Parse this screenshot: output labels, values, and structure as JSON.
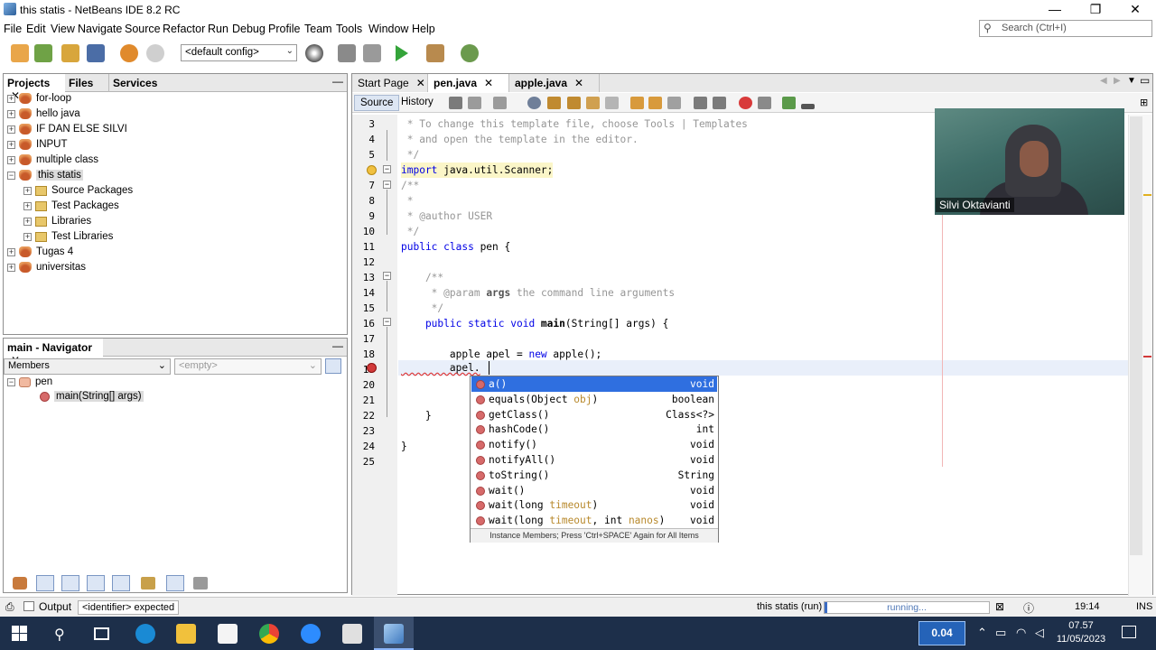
{
  "window": {
    "title": "this statis - NetBeans IDE 8.2 RC",
    "controls": [
      "—",
      "❐",
      "✕"
    ]
  },
  "menu": [
    "File",
    "Edit",
    "View",
    "Navigate",
    "Source",
    "Refactor",
    "Run",
    "Debug",
    "Profile",
    "Team",
    "Tools",
    "Window",
    "Help"
  ],
  "search": {
    "placeholder": "Search (Ctrl+I)"
  },
  "toolbar": {
    "config": "<default config>"
  },
  "projects_panel": {
    "tabs": [
      "Projects",
      "Files",
      "Services"
    ],
    "close": "✕",
    "minimize": "—",
    "tree": [
      {
        "label": "for-loop",
        "level": 0,
        "kind": "project"
      },
      {
        "label": "hello java",
        "level": 0,
        "kind": "project"
      },
      {
        "label": "IF DAN ELSE SILVI",
        "level": 0,
        "kind": "project"
      },
      {
        "label": "INPUT",
        "level": 0,
        "kind": "project"
      },
      {
        "label": "multiple class",
        "level": 0,
        "kind": "project"
      },
      {
        "label": "this statis",
        "level": 0,
        "kind": "project",
        "expanded": true,
        "selected": true
      },
      {
        "label": "Source Packages",
        "level": 1,
        "kind": "folder"
      },
      {
        "label": "Test Packages",
        "level": 1,
        "kind": "folder"
      },
      {
        "label": "Libraries",
        "level": 1,
        "kind": "folder"
      },
      {
        "label": "Test Libraries",
        "level": 1,
        "kind": "folder"
      },
      {
        "label": "Tugas 4",
        "level": 0,
        "kind": "project"
      },
      {
        "label": "universitas",
        "level": 0,
        "kind": "project"
      }
    ]
  },
  "navigator": {
    "title": "main - Navigator",
    "filter": "Members",
    "scope": "<empty>",
    "root": "pen",
    "child": "main(String[] args)"
  },
  "editor": {
    "tabs": [
      {
        "label": "Start Page",
        "active": false
      },
      {
        "label": "pen.java",
        "active": true
      },
      {
        "label": "apple.java",
        "active": false
      }
    ],
    "subtabs": [
      "Source",
      "History"
    ],
    "line_numbers": [
      "3",
      "4",
      "5",
      "6",
      "7",
      "8",
      "9",
      "10",
      "11",
      "12",
      "13",
      "14",
      "15",
      "16",
      "17",
      "18",
      "19",
      "20",
      "21",
      "22",
      "23",
      "24",
      "25"
    ]
  },
  "code": {
    "l3": " * To change this template file, choose Tools | Templates",
    "l4": " * and open the template in the editor.",
    "l5": " */",
    "l6_kw": "import",
    "l6_rest": " java.util.Scanner;",
    "l7": "/**",
    "l8": " *",
    "l9_a": " * ",
    "l9_tag": "@author",
    "l9_b": " USER",
    "l10": " */",
    "l11_kw": "public class",
    "l11_rest": " pen {",
    "l13": "    /**",
    "l14_a": "     * ",
    "l14_tag": "@param",
    "l14_arg": " args",
    "l14_b": " the command line arguments",
    "l15": "     */",
    "l16_kw": "    public static void",
    "l16_name": " main",
    "l16_rest": "(String[] args) {",
    "l18_a": "        apple apel = ",
    "l18_kw": "new",
    "l18_b": " apple();",
    "l19": "        apel.",
    "l22": "    }",
    "l24": "}"
  },
  "completion": {
    "items": [
      {
        "name": "a()",
        "ret": "void",
        "selected": true
      },
      {
        "name": "equals(Object ",
        "param": "obj",
        "tail": ")",
        "ret": "boolean"
      },
      {
        "name": "getClass()",
        "ret": "Class<?>"
      },
      {
        "name": "hashCode()",
        "ret": "int"
      },
      {
        "name": "notify()",
        "ret": "void"
      },
      {
        "name": "notifyAll()",
        "ret": "void"
      },
      {
        "name": "toString()",
        "ret": "String"
      },
      {
        "name": "wait()",
        "ret": "void"
      },
      {
        "name": "wait(long ",
        "param": "timeout",
        "tail": ")",
        "ret": "void"
      },
      {
        "name": "wait(long ",
        "param": "timeout",
        "tail": ", int ",
        "param2": "nanos",
        "tail2": ")",
        "ret": "void"
      }
    ],
    "footer": "Instance Members; Press 'Ctrl+SPACE' Again for All Items"
  },
  "webcam": {
    "name": "Silvi Oktavianti"
  },
  "statusbar": {
    "output_label": "Output",
    "message": "<identifier> expected",
    "run_label": "this statis (run)",
    "progress_text": "running...",
    "position": "19:14",
    "mode": "INS"
  },
  "taskbar": {
    "net": "0.04",
    "time": "07.57",
    "date": "11/05/2023"
  },
  "colors": {
    "accent": "#2f6fe0",
    "keyword": "#0000e6",
    "comment": "#969696",
    "taskbar": "#1d2f4a"
  }
}
